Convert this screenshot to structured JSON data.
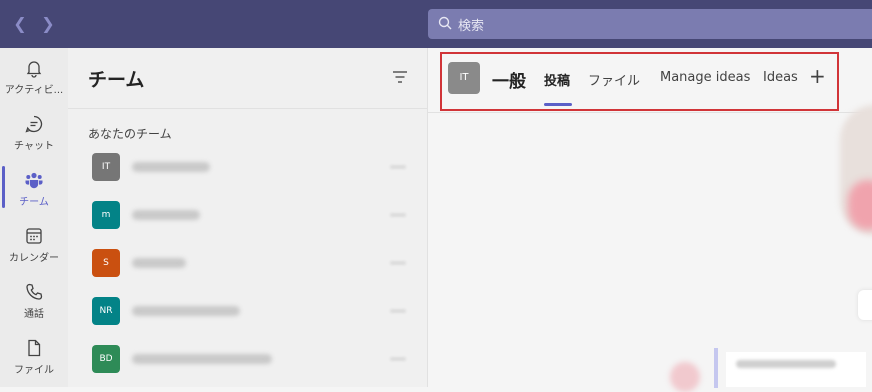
{
  "topbar": {
    "search_placeholder": "検索"
  },
  "rail": {
    "items": [
      {
        "label": "アクティビ...",
        "icon": "bell-icon"
      },
      {
        "label": "チャット",
        "icon": "chat-icon"
      },
      {
        "label": "チーム",
        "icon": "teams-icon",
        "active": true
      },
      {
        "label": "カレンダー",
        "icon": "calendar-icon"
      },
      {
        "label": "通話",
        "icon": "phone-icon"
      },
      {
        "label": "ファイル",
        "icon": "file-icon"
      }
    ]
  },
  "teams_panel": {
    "title": "チーム",
    "section_label": "あなたのチーム",
    "teams": [
      {
        "initials": "IT",
        "color": "#767676"
      },
      {
        "initials": "m",
        "color": "#038387"
      },
      {
        "initials": "S",
        "color": "#ca5010"
      },
      {
        "initials": "NR",
        "color": "#038387"
      },
      {
        "initials": "BD",
        "color": "#2e8b57"
      }
    ]
  },
  "channel": {
    "avatar_initials": "IT",
    "title": "一般",
    "tabs": [
      "投稿",
      "ファイル",
      "Manage ideas",
      "Ideas"
    ],
    "active_tab": "投稿"
  },
  "colors": {
    "accent": "#5b5fc7",
    "topbar": "#464775",
    "highlight": "#d13438"
  }
}
